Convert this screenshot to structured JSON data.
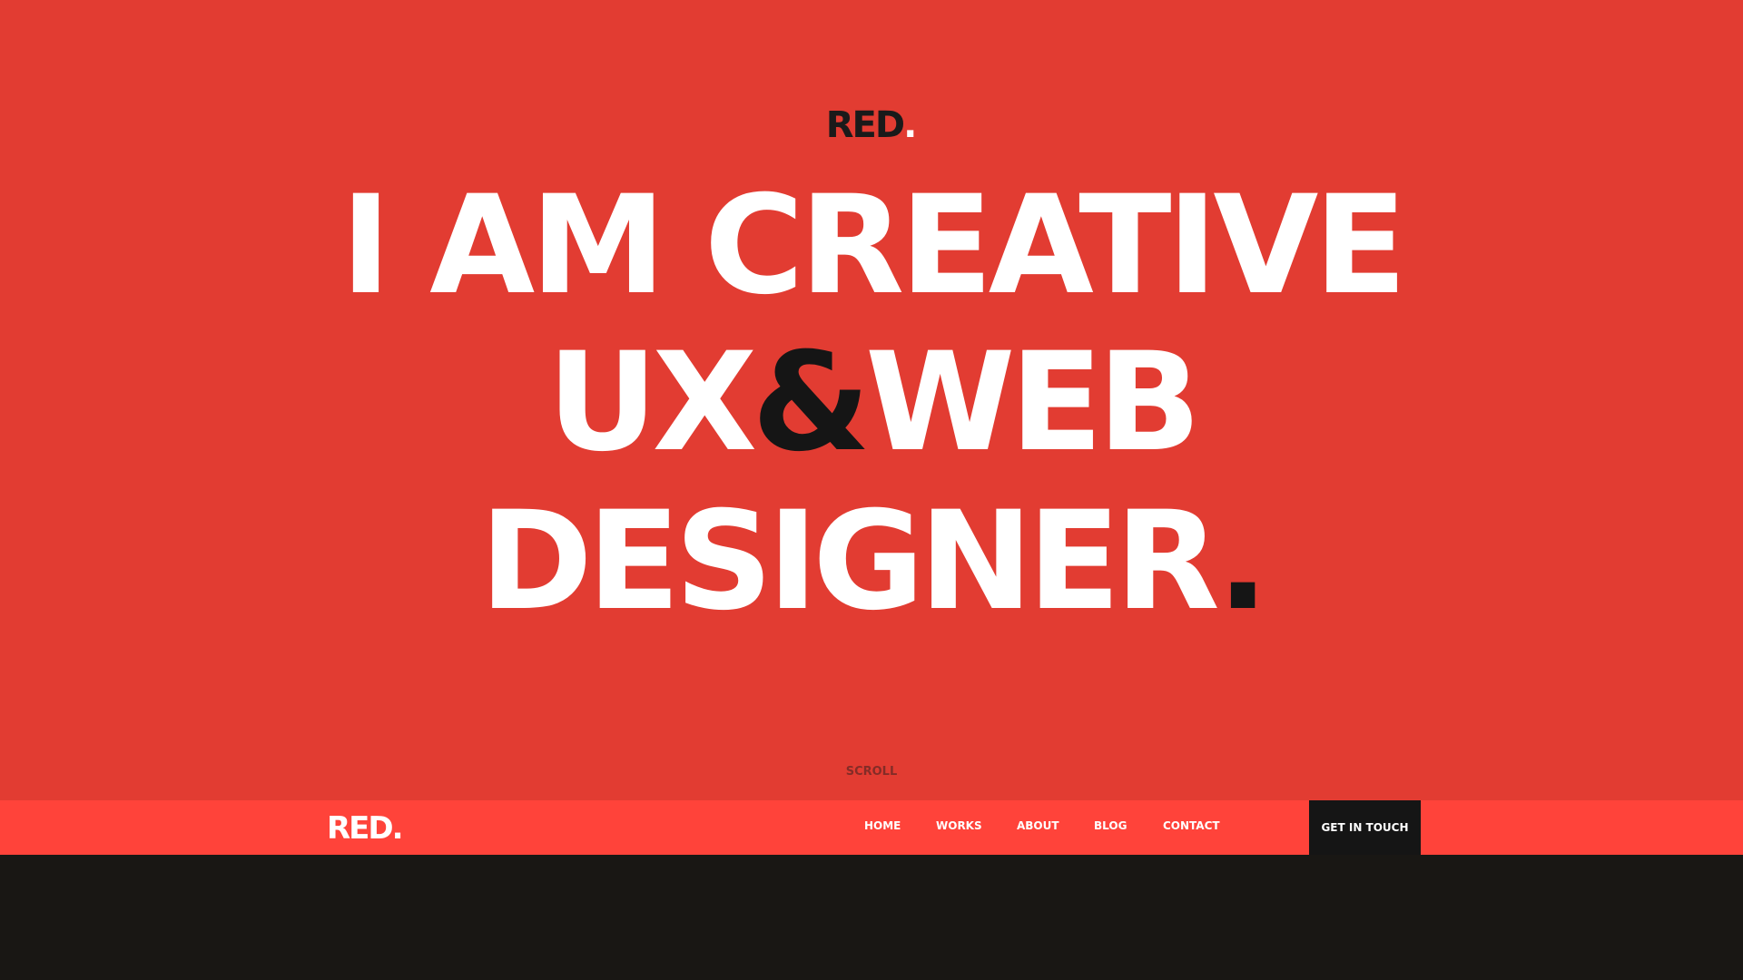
{
  "colors": {
    "hero_bg": "#E23C32",
    "navbar_bg": "#FF433A",
    "dark": "#151515",
    "footer_bg": "#191714",
    "text_light": "#FFFFFF"
  },
  "hero": {
    "logo_text": "RED",
    "logo_dot": ".",
    "line1": "I AM CREATIVE",
    "line2_a": "UX",
    "line2_amp": "&",
    "line2_b": "WEB",
    "line3": "DESIGNER",
    "line3_dot": ".",
    "scroll_label": "SCROLL"
  },
  "navbar": {
    "logo_text": "RED",
    "logo_dot": ".",
    "items": [
      {
        "label": "HOME"
      },
      {
        "label": "WORKS"
      },
      {
        "label": "ABOUT"
      },
      {
        "label": "BLOG"
      },
      {
        "label": "CONTACT"
      }
    ],
    "cta_label": "GET IN TOUCH"
  }
}
